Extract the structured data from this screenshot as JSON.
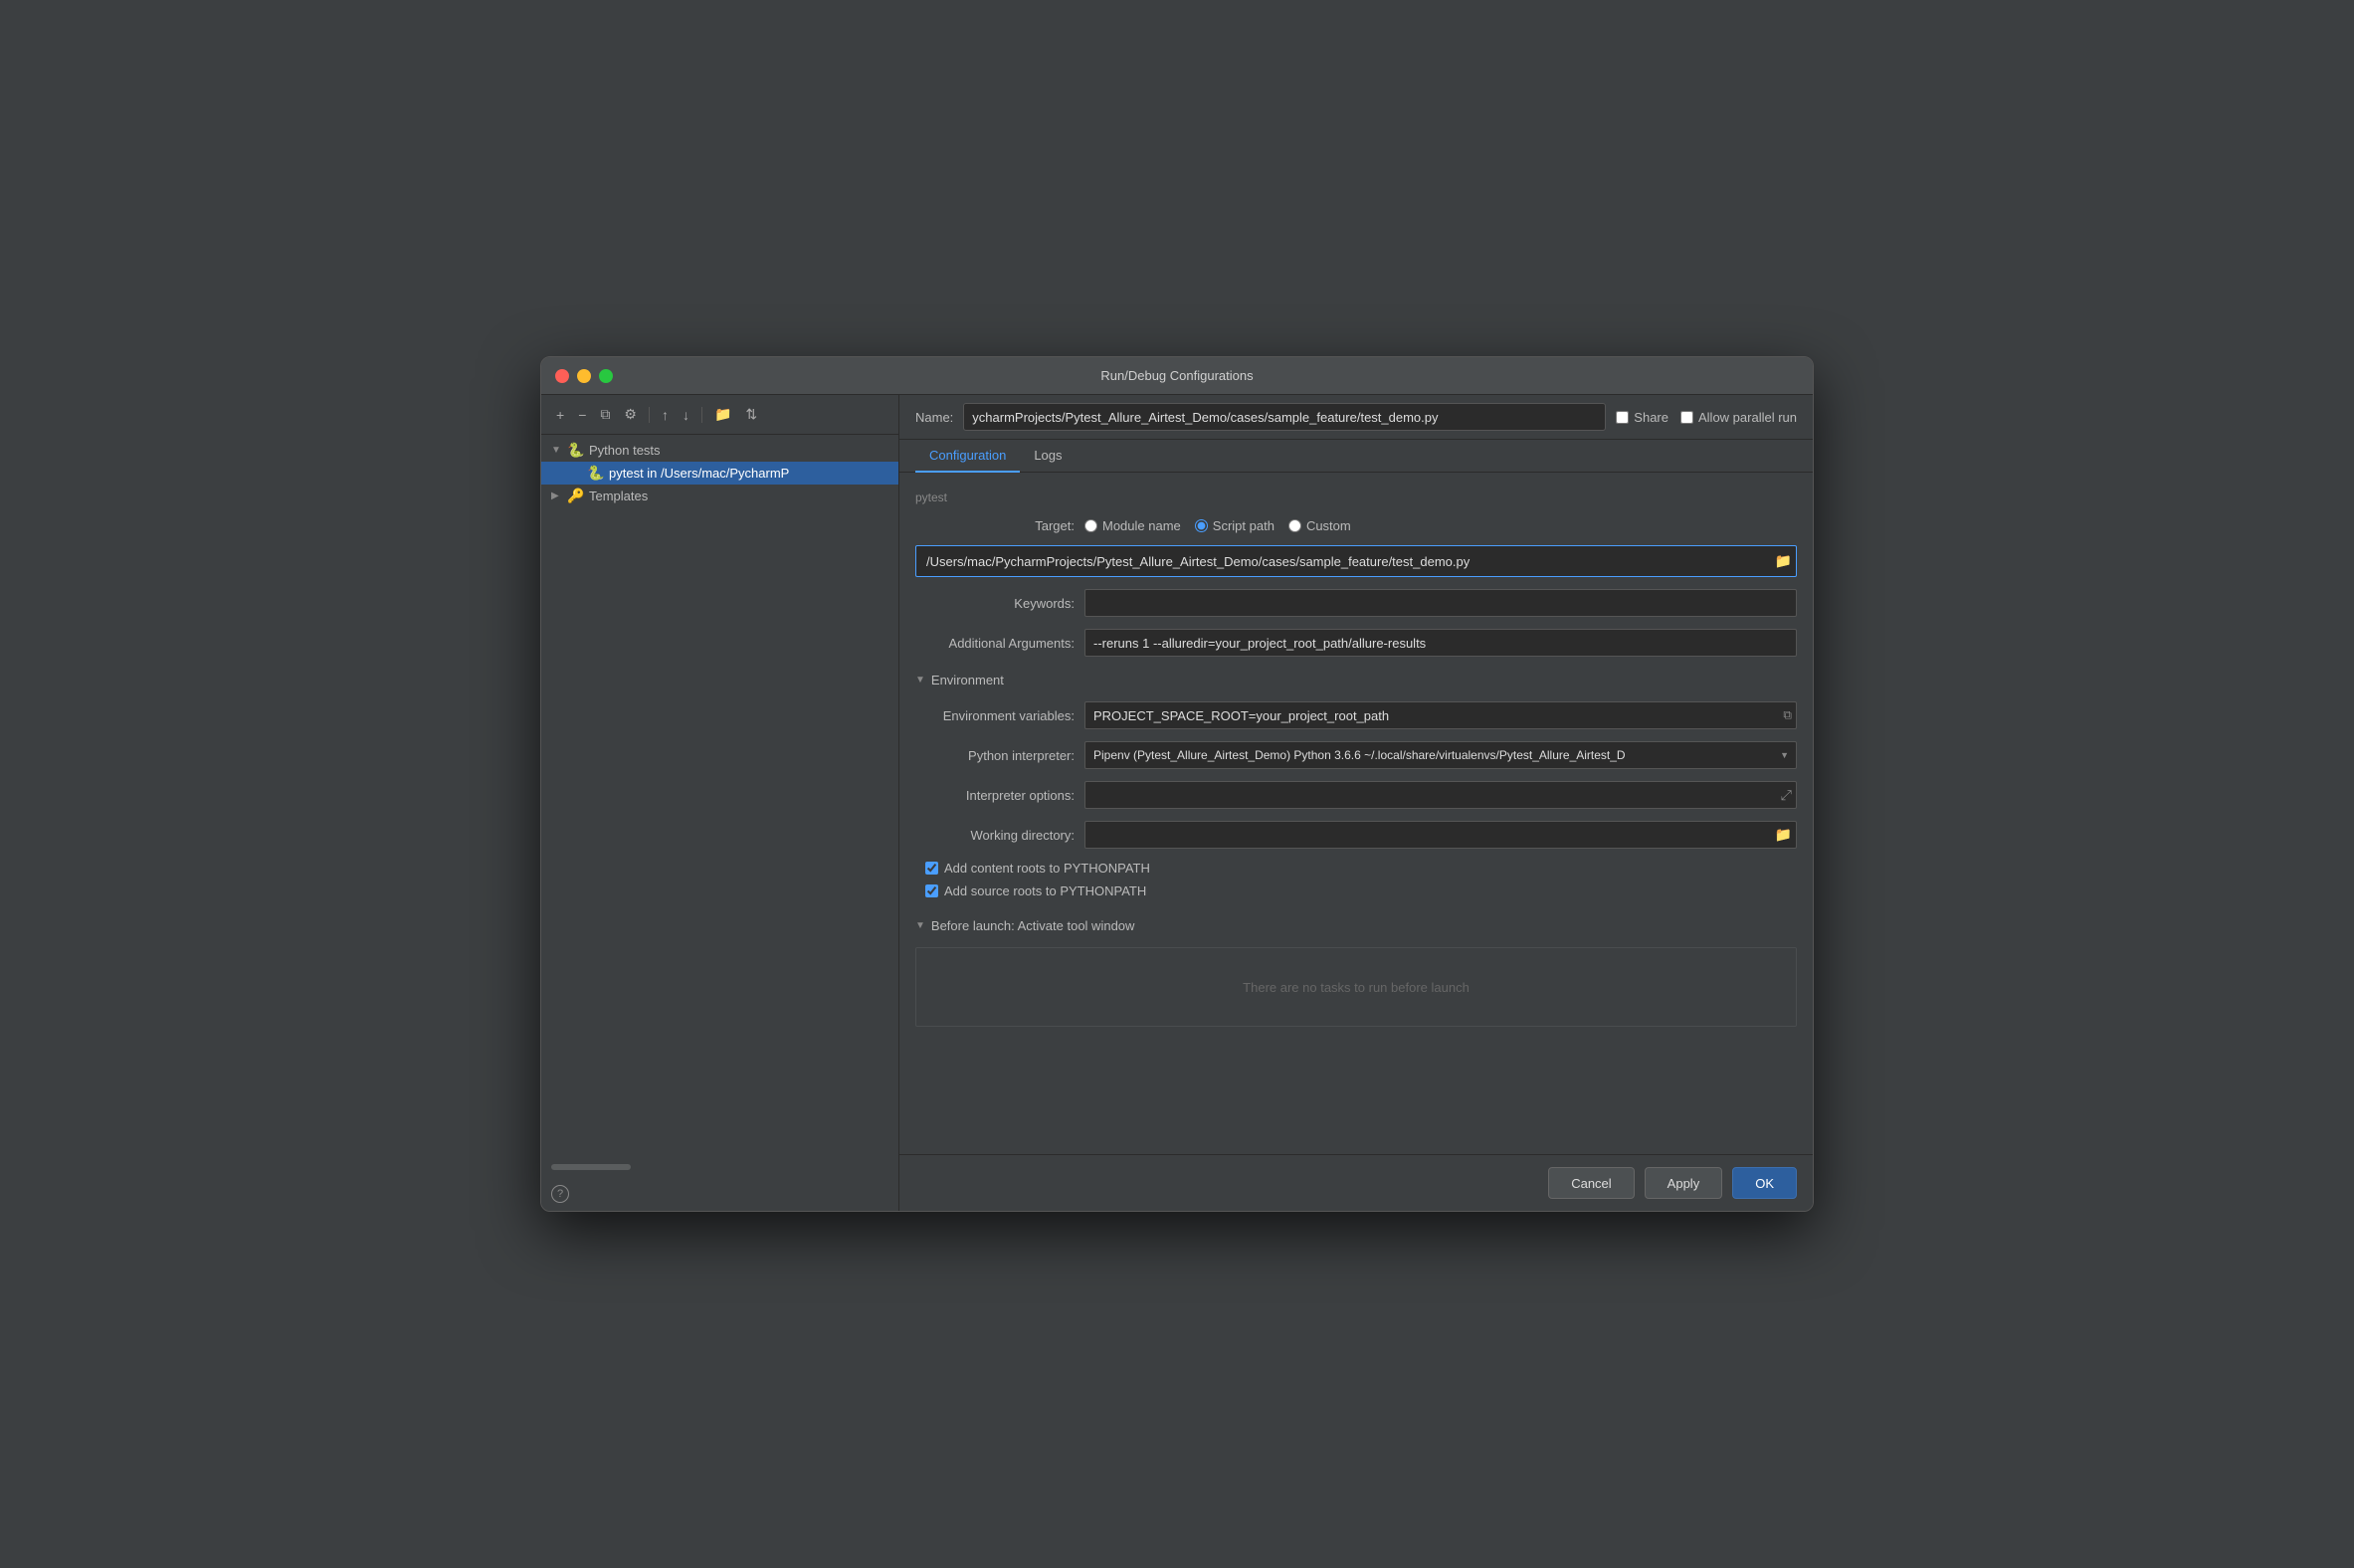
{
  "window": {
    "title": "Run/Debug Configurations"
  },
  "sidebar": {
    "toolbar": {
      "add_label": "+",
      "remove_label": "−",
      "copy_label": "⧉",
      "settings_label": "⚙",
      "up_label": "↑",
      "down_label": "↓",
      "folder_label": "📁",
      "sort_label": "⇅"
    },
    "tree": {
      "python_tests_label": "Python tests",
      "pytest_item_label": "pytest in /Users/mac/PycharmP",
      "templates_label": "Templates"
    }
  },
  "header": {
    "name_label": "Name:",
    "name_value": "ycharmProjects/Pytest_Allure_Airtest_Demo/cases/sample_feature/test_demo.py",
    "share_label": "Share",
    "parallel_label": "Allow parallel run"
  },
  "tabs": {
    "configuration_label": "Configuration",
    "logs_label": "Logs"
  },
  "config": {
    "section_label": "pytest",
    "target_label": "Target:",
    "target_options": [
      {
        "id": "module",
        "label": "Module name"
      },
      {
        "id": "script",
        "label": "Script path",
        "selected": true
      },
      {
        "id": "custom",
        "label": "Custom"
      }
    ],
    "script_path_value": "/Users/mac/PycharmProjects/Pytest_Allure_Airtest_Demo/cases/sample_feature/test_demo.py",
    "keywords_label": "Keywords:",
    "keywords_value": "",
    "additional_args_label": "Additional Arguments:",
    "additional_args_value": "--reruns 1 --alluredir=your_project_root_path/allure-results",
    "environment_label": "Environment",
    "env_vars_label": "Environment variables:",
    "env_vars_value": "PROJECT_SPACE_ROOT=your_project_root_path",
    "python_interpreter_label": "Python interpreter:",
    "interpreter_value": "Pipenv (Pytest_Allure_Airtest_Demo) Python 3.6.6 ~/.local/share/virtualenvs/Pytest_Allure_Airtest_D",
    "interpreter_options_label": "Interpreter options:",
    "interpreter_options_value": "",
    "working_dir_label": "Working directory:",
    "working_dir_value": "",
    "add_content_roots_label": "Add content roots to PYTHONPATH",
    "add_content_roots_checked": true,
    "add_source_roots_label": "Add source roots to PYTHONPATH",
    "add_source_roots_checked": true,
    "before_launch_label": "Before launch: Activate tool window",
    "no_tasks_label": "There are no tasks to run before launch"
  },
  "buttons": {
    "cancel_label": "Cancel",
    "apply_label": "Apply",
    "ok_label": "OK"
  }
}
